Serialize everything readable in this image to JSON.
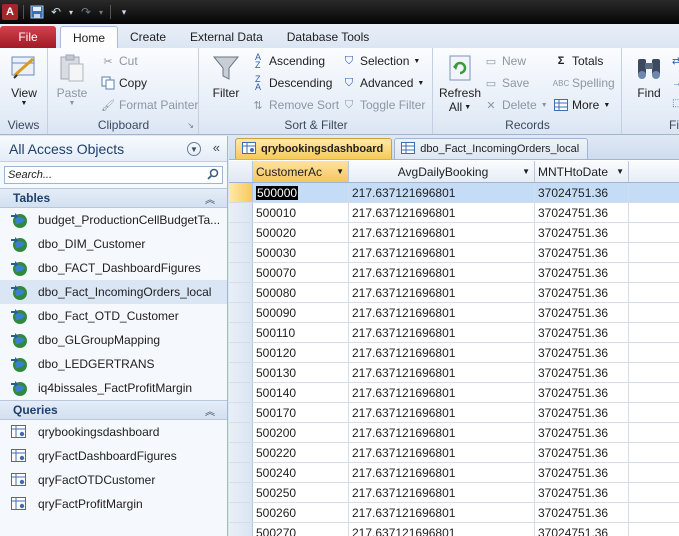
{
  "window": {
    "app_icon_letter": "A"
  },
  "ribbon_tabs": {
    "file": "File",
    "items": [
      "Home",
      "Create",
      "External Data",
      "Database Tools"
    ],
    "active": "Home"
  },
  "ribbon": {
    "views": {
      "view_label": "View",
      "group_label": "Views"
    },
    "clipboard": {
      "paste_label": "Paste",
      "cut_label": "Cut",
      "copy_label": "Copy",
      "format_painter_label": "Format Painter",
      "group_label": "Clipboard"
    },
    "sort_filter": {
      "filter_label": "Filter",
      "ascending_label": "Ascending",
      "descending_label": "Descending",
      "remove_sort_label": "Remove Sort",
      "selection_label": "Selection",
      "advanced_label": "Advanced",
      "toggle_filter_label": "Toggle Filter",
      "group_label": "Sort & Filter"
    },
    "records": {
      "refresh_label": "Refresh",
      "refresh_sub": "All",
      "new_label": "New",
      "save_label": "Save",
      "delete_label": "Delete",
      "totals_label": "Totals",
      "spelling_label": "Spelling",
      "more_label": "More",
      "group_label": "Records"
    },
    "find": {
      "find_label": "Find",
      "group_label_partial": "Fi"
    }
  },
  "nav": {
    "title": "All Access Objects",
    "search_placeholder": "Search...",
    "tables_header": "Tables",
    "tables": [
      "budget_ProductionCellBudgetTa...",
      "dbo_DIM_Customer",
      "dbo_FACT_DashboardFigures",
      "dbo_Fact_IncomingOrders_local",
      "dbo_Fact_OTD_Customer",
      "dbo_GLGroupMapping",
      "dbo_LEDGERTRANS",
      "iq4bissales_FactProfitMargin"
    ],
    "queries_header": "Queries",
    "queries": [
      "qrybookingsdashboard",
      "qryFactDashboardFigures",
      "qryFactOTDCustomer",
      "qryFactProfitMargin"
    ]
  },
  "doc_tabs": [
    {
      "label": "qrybookingsdashboard",
      "active": true
    },
    {
      "label": "dbo_Fact_IncomingOrders_local",
      "active": false
    }
  ],
  "grid": {
    "columns": [
      "CustomerAc",
      "AvgDailyBooking",
      "MNTHtoDate"
    ],
    "rows": [
      [
        "500000",
        "217.637121696801",
        "37024751.36"
      ],
      [
        "500010",
        "217.637121696801",
        "37024751.36"
      ],
      [
        "500020",
        "217.637121696801",
        "37024751.36"
      ],
      [
        "500030",
        "217.637121696801",
        "37024751.36"
      ],
      [
        "500070",
        "217.637121696801",
        "37024751.36"
      ],
      [
        "500080",
        "217.637121696801",
        "37024751.36"
      ],
      [
        "500090",
        "217.637121696801",
        "37024751.36"
      ],
      [
        "500110",
        "217.637121696801",
        "37024751.36"
      ],
      [
        "500120",
        "217.637121696801",
        "37024751.36"
      ],
      [
        "500130",
        "217.637121696801",
        "37024751.36"
      ],
      [
        "500140",
        "217.637121696801",
        "37024751.36"
      ],
      [
        "500170",
        "217.637121696801",
        "37024751.36"
      ],
      [
        "500200",
        "217.637121696801",
        "37024751.36"
      ],
      [
        "500220",
        "217.637121696801",
        "37024751.36"
      ],
      [
        "500240",
        "217.637121696801",
        "37024751.36"
      ],
      [
        "500250",
        "217.637121696801",
        "37024751.36"
      ],
      [
        "500260",
        "217.637121696801",
        "37024751.36"
      ],
      [
        "500270",
        "217.637121696801",
        "37024751.36"
      ]
    ]
  }
}
